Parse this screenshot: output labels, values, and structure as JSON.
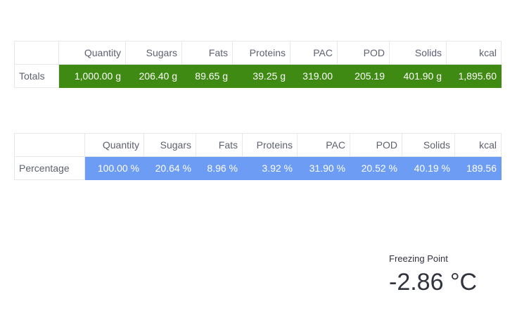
{
  "totals": {
    "row_label": "Totals",
    "headers": [
      "Quantity",
      "Sugars",
      "Fats",
      "Proteins",
      "PAC",
      "POD",
      "Solids",
      "kcal"
    ],
    "values": [
      "1,000.00 g",
      "206.40 g",
      "89.65 g",
      "39.25 g",
      "319.00",
      "205.19",
      "401.90 g",
      "1,895.60"
    ],
    "color": "#3e8a12"
  },
  "percentage": {
    "row_label": "Percentage",
    "headers": [
      "Quantity",
      "Sugars",
      "Fats",
      "Proteins",
      "PAC",
      "POD",
      "Solids",
      "kcal"
    ],
    "values": [
      "100.00 %",
      "20.64 %",
      "8.96 %",
      "3.92 %",
      "31.90 %",
      "20.52 %",
      "40.19 %",
      "189.56"
    ],
    "color": "#6d9cf5"
  },
  "metric": {
    "label": "Freezing Point",
    "value": "-2.86 °C"
  }
}
